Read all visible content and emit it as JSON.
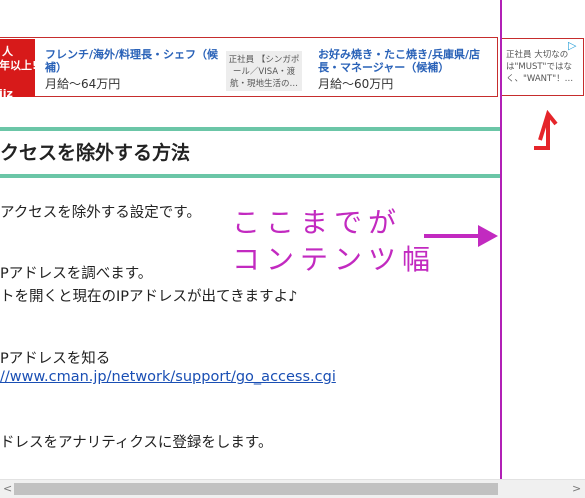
{
  "ad": {
    "left_label_1": "人",
    "left_label_2": "年以上!",
    "left_label_3": "iiz",
    "job1_title": "フレンチ/海外/料理長・シェフ（候補）",
    "job1_salary": "月給〜64万円",
    "job1_detail": "正社員 【シンガポール／VISA・渡航・現地生活の…",
    "job2_title": "お好み焼き・たこ焼き/兵庫県/店長・マネージャー（候補）",
    "job2_salary": "月給〜60万円",
    "job3_detail": "正社員 大切なのは\"MUST\"ではなく、\"WANT\"！…",
    "adchoices": "▷"
  },
  "article": {
    "heading": "クセスを除外する方法",
    "line1": "アクセスを除外する設定です。",
    "line2": "Pアドレスを調べます。",
    "line3": "トを開くと現在のIPアドレスが出てきますよ♪",
    "line4": "Pアドレスを知る",
    "link": "//www.cman.jp/network/support/go_access.cgi",
    "line5": "ドレスをアナリティクスに登録をします。"
  },
  "annotation": {
    "line1": "ここまでが",
    "line2": "コンテンツ幅",
    "color": "#c22ac0"
  },
  "scrollbar": {
    "left_arrow": "<",
    "right_arrow": ">"
  }
}
